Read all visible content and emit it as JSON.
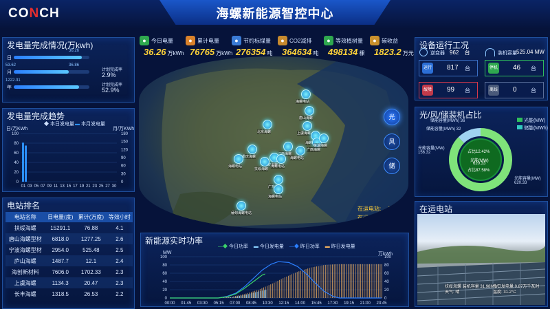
{
  "header": {
    "logo": "CONCH",
    "title": "海螺新能源智控中心"
  },
  "stats": [
    {
      "label": "今日电量",
      "value": "36.26",
      "unit": "万kWh",
      "icon": "lightning-icon",
      "color": "#2fa84f"
    },
    {
      "label": "累计电量",
      "value": "76765",
      "unit": "万kWh",
      "icon": "battery-icon",
      "color": "#d9822b"
    },
    {
      "label": "节约标煤量",
      "value": "276354",
      "unit": "吨",
      "icon": "truck-icon",
      "color": "#3a7bd5"
    },
    {
      "label": "CO2减排",
      "value": "364634",
      "unit": "吨",
      "icon": "cloud-icon",
      "color": "#c78a2e"
    },
    {
      "label": "等效植树量",
      "value": "498134",
      "unit": "棵",
      "icon": "tree-icon",
      "color": "#2fa84f"
    },
    {
      "label": "碳收益",
      "value": "1823.2",
      "unit": "万元",
      "icon": "money-bag-icon",
      "color": "#c9902d"
    }
  ],
  "completion": {
    "title": "发电量完成情况(万kwh)",
    "rows": [
      {
        "label": "日",
        "bar_fraction": 0.9,
        "left_val": "",
        "right_val": "36.26",
        "rate_label": "",
        "rate": ""
      },
      {
        "label": "月",
        "bar_fraction": 0.73,
        "left_val": "53.62",
        "right_val": "36.86",
        "rate_label": "计划完成率",
        "rate": "2.9%"
      },
      {
        "label": "年",
        "bar_fraction": 0.86,
        "left_val": "1222.31",
        "right_val": "",
        "rate_label": "计划完成率",
        "rate": "52.9%"
      }
    ]
  },
  "trend": {
    "title": "发电量完成趋势",
    "y_left_label": "日/万KWh",
    "y_right_label": "月/万KWh",
    "legend": [
      "本日发电量",
      "本月发电量"
    ]
  },
  "trend_chart": {
    "type": "bar",
    "x_ticks": [
      "01",
      "03",
      "05",
      "07",
      "09",
      "11",
      "13",
      "15",
      "17",
      "19",
      "21",
      "23",
      "25",
      "27",
      "30"
    ],
    "y_left_ticks": [
      "0",
      "20",
      "40",
      "60",
      "80",
      "100"
    ],
    "y_right_ticks": [
      "0",
      "30",
      "60",
      "90",
      "120",
      "150",
      "180"
    ],
    "ylim_left": [
      0,
      100
    ],
    "ylim_right": [
      0,
      180
    ],
    "series": [
      {
        "name": "本日发电量",
        "x": [
          "01",
          "02"
        ],
        "values": [
          81,
          75
        ]
      },
      {
        "name": "本月发电量",
        "x": [
          "01"
        ],
        "values": [
          0
        ]
      }
    ]
  },
  "ranking": {
    "title": "电站排名",
    "columns": [
      "电站名称",
      "日电量(度)",
      "累计(万度)",
      "等效小时"
    ],
    "rows": [
      [
        "扶绥海螺",
        "15291.1",
        "76.88",
        "4.1"
      ],
      [
        "唐山海螺型材",
        "6818.0",
        "1277.25",
        "2.6"
      ],
      [
        "宁波海螺型材",
        "2954.0",
        "525.48",
        "2.5"
      ],
      [
        "庐山海螺",
        "1487.7",
        "12.1",
        "2.4"
      ],
      [
        "海创新材料",
        "7606.0",
        "1702.33",
        "2.3"
      ],
      [
        "上虞海螺",
        "1134.3",
        "20.47",
        "2.3"
      ],
      [
        "长丰海螺",
        "1318.5",
        "26.53",
        "2.2"
      ]
    ]
  },
  "map": {
    "info_label1": "在运电站:",
    "info_val1": "76座",
    "info_label2": "在运容量:",
    "info_val2": "525.0MW",
    "buttons": [
      "光",
      "风",
      "储"
    ],
    "marker_labels": [
      "海螺电站",
      "唐山海螺",
      "北京海螺",
      "上虞海螺",
      "海螺电站",
      "重庆海螺",
      "江西海螺",
      "广西海螺",
      "芜湖海螺",
      "海螺电站",
      "宁波海螺",
      "扶绥海螺",
      "海螺电站",
      "海螺电站",
      "广东海螺",
      "海螺电站",
      "缅甸海螺电站"
    ]
  },
  "devices": {
    "title": "设备运行工况",
    "inverter_label": "逆变器",
    "inverter_count": "962",
    "inverter_unit": "台",
    "power_label": "装机容量",
    "power_value": "525.04",
    "power_unit": "MW",
    "items": [
      {
        "label": "运行",
        "value": "817",
        "unit": "台",
        "color": "#2c6fd6",
        "border": "#3a6fc4"
      },
      {
        "label": "停机",
        "value": "46",
        "unit": "台",
        "color": "#2fa84f",
        "border": "#2fbf5c"
      },
      {
        "label": "故障",
        "value": "99",
        "unit": "台",
        "color": "#c23a4a",
        "border": "#d6384a"
      },
      {
        "label": "离线",
        "value": "0",
        "unit": "台",
        "color": "#4a5a7a",
        "border": "#5b6f9a"
      }
    ]
  },
  "share": {
    "title": "光/风/储装机占比",
    "legend": [
      {
        "label": "光能(MW)",
        "color": "#2fbf5c"
      },
      {
        "label": "储能(MWh)",
        "color": "#33c9c0"
      }
    ],
    "labels": [
      {
        "text": "储能容量(MWh)",
        "value": "36"
      },
      {
        "text": "储能容量(MWh)",
        "value": "32"
      },
      {
        "text": "光能容量(MW)",
        "value": "156.32"
      },
      {
        "text": "光能容量(MW)",
        "value": "620.33"
      }
    ],
    "inner_labels": [
      "占比12.42%",
      "光能(MW)",
      "620.33",
      "占比87.58%"
    ],
    "slices": [
      {
        "name": "光能",
        "value": 87.58,
        "color": "#7fe37a"
      },
      {
        "name": "储能",
        "value": 12.42,
        "color": "#9fd2f0"
      }
    ]
  },
  "running_station": {
    "title": "在运电站",
    "caption_left": "扶绥海螺",
    "caption_left2": "装机容量 31.98MW",
    "caption_left3": "天气: 晴",
    "caption_right": "今日发电量 0.87万千瓦时",
    "caption_right2": "温度: 31.2°C"
  },
  "realtime": {
    "title": "新能源实时功率",
    "legend": [
      "今日功率",
      "今日发电量",
      "昨日功率",
      "昨日发电量"
    ],
    "y_left_label": "MW",
    "y_right_label": "万kWh"
  },
  "realtime_chart": {
    "type": "line",
    "x_ticks": [
      "00:00",
      "01:45",
      "03:30",
      "05:15",
      "07:00",
      "08:45",
      "10:30",
      "12:15",
      "14:00",
      "15:45",
      "17:30",
      "19:15",
      "21:00",
      "23:45"
    ],
    "y_left_ticks": [
      "0",
      "20",
      "40",
      "60",
      "80",
      "100"
    ],
    "y_right_ticks": [
      "0",
      "20",
      "40",
      "60",
      "80",
      "100"
    ],
    "ylim_left": [
      0,
      100
    ],
    "ylim_right": [
      0,
      100
    ],
    "series": [
      {
        "name": "昨日功率",
        "x_hours": [
          0,
          5.5,
          6.5,
          7.5,
          8.5,
          9.5,
          10.5,
          11.5,
          12.3,
          13.5,
          14.5,
          15.5,
          16.5,
          17.5,
          18.5,
          19.2,
          24
        ],
        "values": [
          0,
          0,
          4,
          12,
          28,
          48,
          68,
          82,
          88,
          86,
          76,
          58,
          36,
          16,
          4,
          0,
          0
        ]
      },
      {
        "name": "今日功率",
        "x_hours": [
          0,
          5.5,
          6.5,
          7.5,
          8.5,
          9.5,
          10.5,
          10.8
        ],
        "values": [
          0,
          0,
          3,
          10,
          24,
          40,
          56,
          58
        ]
      },
      {
        "name": "昨日发电量",
        "x_hours": [
          5.5,
          7,
          8.5,
          10,
          11.5,
          13,
          14.5,
          16,
          17.5,
          19,
          21,
          24
        ],
        "values": [
          0,
          3,
          10,
          20,
          34,
          50,
          64,
          74,
          80,
          82,
          82,
          82
        ]
      },
      {
        "name": "今日发电量",
        "x_hours": [
          5.5,
          7,
          8.5,
          10,
          10.8
        ],
        "values": [
          0,
          2,
          8,
          16,
          20
        ]
      }
    ]
  }
}
